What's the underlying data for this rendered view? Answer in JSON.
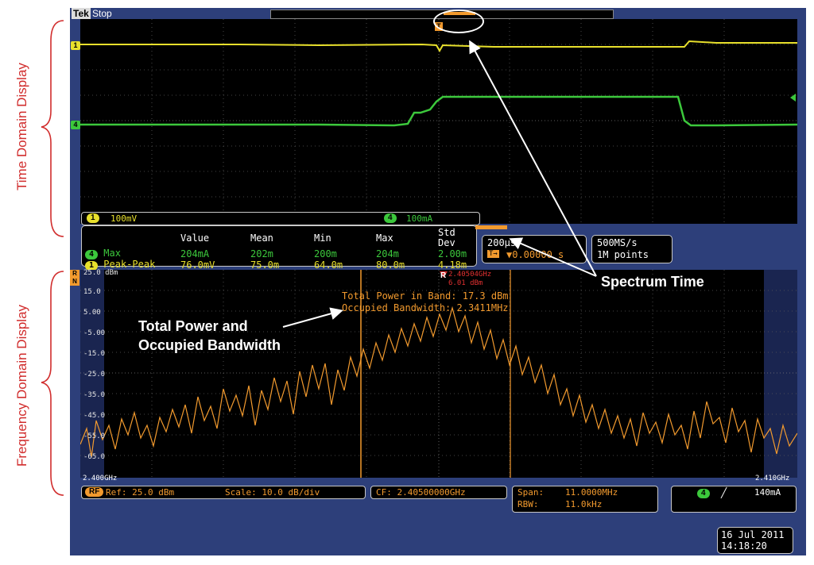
{
  "header": {
    "brand": "Tek",
    "run_state": "Stop"
  },
  "side_labels": {
    "time": "Time Domain Display",
    "frequency": "Frequency Domain Display"
  },
  "channels": {
    "ch1": {
      "number": "1",
      "scale": "100mV",
      "color": "#e8e02c"
    },
    "ch4": {
      "number": "4",
      "scale": "100mA",
      "color": "#3cc83c"
    },
    "rf": {
      "label": "RF",
      "color": "#f29a2e"
    }
  },
  "trigger_marker": "T",
  "measurements": {
    "headers": [
      "Value",
      "Mean",
      "Min",
      "Max",
      "Std Dev"
    ],
    "rows": [
      {
        "ch": "4",
        "name": "Max",
        "values": [
          "204mA",
          "202m",
          "200m",
          "204m",
          "2.00m"
        ]
      },
      {
        "ch": "1",
        "name": "Peak-Peak",
        "values": [
          "76.0mV",
          "75.0m",
          "64.0m",
          "80.0m",
          "4.18m"
        ]
      }
    ]
  },
  "horizontal": {
    "timebase": "200µs",
    "position": "▼0.00000 s",
    "sample_rate": "500MS/s",
    "record_length": "1M points"
  },
  "spectrum": {
    "y_ticks": [
      "25.0 dBm",
      "15.0",
      "5.00",
      "-5.00",
      "-15.0",
      "-25.0",
      "-35.0",
      "-45.0",
      "-55.0",
      "-65.0"
    ],
    "marker_label": "R",
    "marker_freq": "2.40504GHz",
    "marker_level": "6.01 dBm",
    "band_power": "Total Power in Band: 17.3 dBm",
    "occupied_bw": "Occupied Bandwidth: 2.3411MHz",
    "start_freq": "2.400GHz",
    "stop_freq": "2.410GHz"
  },
  "annotations": {
    "spectrum_time": "Spectrum Time",
    "power_line1": "Total Power and",
    "power_line2": "Occupied Bandwidth"
  },
  "bottom": {
    "ref": "Ref: 25.0 dBm",
    "scale": "Scale: 10.0 dB/div",
    "cf": "CF: 2.40500000GHz",
    "span_label": "Span:",
    "span_value": "11.0000MHz",
    "rbw_label": "RBW:",
    "rbw_value": "11.0kHz",
    "trigger_level": "140mA",
    "date": "16 Jul 2011",
    "time": "14:18:20"
  }
}
